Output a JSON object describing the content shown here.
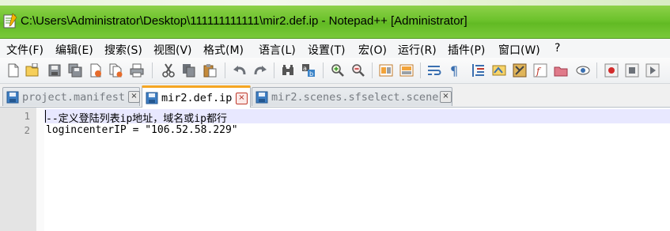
{
  "window": {
    "title": "C:\\Users\\Administrator\\Desktop\\111111111111\\mir2.def.ip - Notepad++ [Administrator]"
  },
  "menu": {
    "items": [
      {
        "label": "文件(F)"
      },
      {
        "label": "编辑(E)"
      },
      {
        "label": "搜索(S)"
      },
      {
        "label": "视图(V)"
      },
      {
        "label": "格式(M)"
      },
      {
        "label": "语言(L)"
      },
      {
        "label": "设置(T)"
      },
      {
        "label": "宏(O)"
      },
      {
        "label": "运行(R)"
      },
      {
        "label": "插件(P)"
      },
      {
        "label": "窗口(W)"
      },
      {
        "label": "?"
      }
    ]
  },
  "toolbar": {
    "icons": [
      "new-file-icon",
      "open-file-icon",
      "save-icon",
      "save-all-icon",
      "close-icon",
      "close-all-icon",
      "print-icon",
      "cut-icon",
      "copy-icon",
      "paste-icon",
      "undo-icon",
      "redo-icon",
      "find-icon",
      "replace-icon",
      "zoom-in-icon",
      "zoom-out-icon",
      "sync-vertical-icon",
      "sync-horizontal-icon",
      "word-wrap-icon",
      "show-all-chars-icon",
      "indent-guide-icon",
      "user-lang-icon",
      "doc-map-icon",
      "function-list-icon",
      "folder-workspace-icon",
      "monitor-icon",
      "record-macro-icon",
      "stop-record-icon",
      "play-macro-icon"
    ]
  },
  "tabs": [
    {
      "label": "project.manifest",
      "active": false,
      "close": "×"
    },
    {
      "label": "mir2.def.ip",
      "active": true,
      "close": "×"
    },
    {
      "label": "mir2.scenes.sfselect.scene",
      "active": false,
      "close": "×"
    }
  ],
  "editor": {
    "lines": [
      {
        "number": "1",
        "text": "--定义登陆列表ip地址，域名或ip都行"
      },
      {
        "number": "2",
        "text": "logincenterIP = \"106.52.58.229\""
      }
    ]
  },
  "colors": {
    "titlebar": "#6cc22c",
    "active_tab_accent": "#f5a623",
    "current_line": "#e8e8ff",
    "gutter": "#e4e4e4"
  }
}
